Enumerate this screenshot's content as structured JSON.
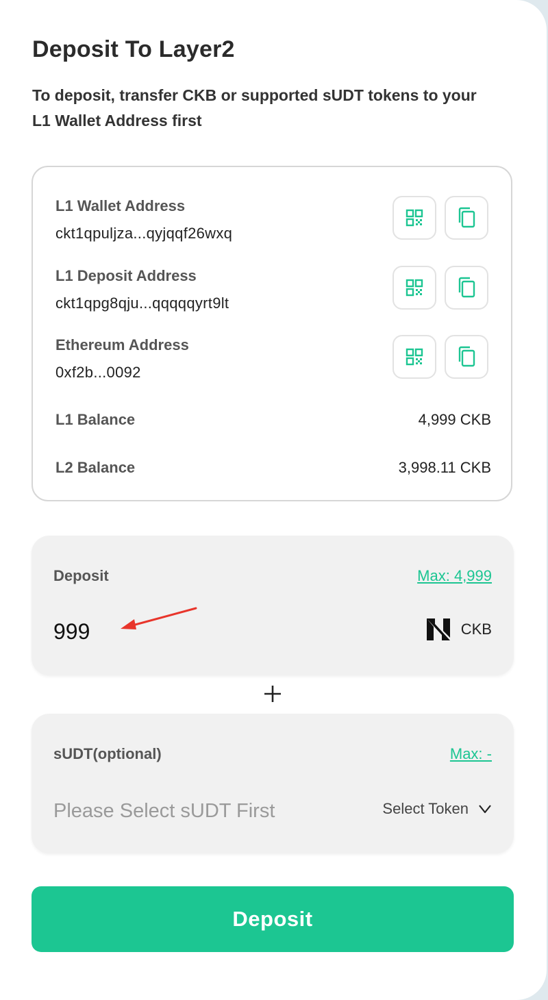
{
  "header": {
    "title": "Deposit To Layer2",
    "subtitle": "To deposit, transfer CKB or supported sUDT tokens to your L1 Wallet Address first"
  },
  "addresses": [
    {
      "label": "L1 Wallet Address",
      "value": "ckt1qpuljza...qyjqqf26wxq"
    },
    {
      "label": "L1 Deposit Address",
      "value": "ckt1qpg8qju...qqqqqyrt9lt"
    },
    {
      "label": "Ethereum Address",
      "value": "0xf2b...0092"
    }
  ],
  "balances": [
    {
      "label": "L1 Balance",
      "value": "4,999 CKB"
    },
    {
      "label": "L2 Balance",
      "value": "3,998.11 CKB"
    }
  ],
  "deposit_panel": {
    "label": "Deposit",
    "max_link": "Max: 4,999",
    "amount": "999",
    "token": "CKB",
    "token_icon": "nervos-logo-icon"
  },
  "sudt_panel": {
    "label": "sUDT(optional)",
    "max_link": "Max: -",
    "placeholder": "Please Select sUDT First",
    "select_label": "Select Token"
  },
  "submit": {
    "label": "Deposit"
  },
  "colors": {
    "accent": "#1cc692",
    "panel_bg": "#f1f1f1",
    "annotation_arrow": "#e8352b"
  }
}
